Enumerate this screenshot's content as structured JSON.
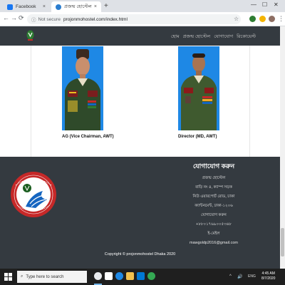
{
  "browser": {
    "tabs": [
      {
        "label": "Facebook",
        "favicon": "facebook-icon"
      },
      {
        "label": "প্রজন্ম হোস্টেল",
        "favicon": "site-favicon"
      }
    ],
    "close_glyph": "×",
    "new_tab_glyph": "+",
    "window_controls": [
      "—",
      "☐",
      "✕"
    ],
    "back_glyph": "←",
    "forward_glyph": "→",
    "reload_glyph": "⟳",
    "security": "Not secure",
    "url": "projonmohostel.com/index.html",
    "bookmark_glyph": "☆",
    "menu_glyph": "⋮"
  },
  "site": {
    "nav_links": [
      "হোম",
      "প্রজন্ম হোস্টেল",
      "যোগাযোগ",
      "রিকোয়েস্ট"
    ],
    "people": [
      {
        "caption": "AG (Vice Chairman, AWT)"
      },
      {
        "caption": "Director (MD, AWT)"
      }
    ],
    "contact": {
      "heading": "যোগাযোগ করুন",
      "lines": [
        "প্রজন্ম হোস্টেল",
        "বাড়ি নং ৪, ক্যাম্প সড়ক",
        "নিউ এয়ারপোর্ট রোড, ঢাকা",
        "ক্যান্টনমেন্ট, ঢাকা-১২০৬",
        "যোগাযোগ করুন",
        "+৮৮০১৭৬৯০০৫৩৬৮",
        "ই-মেইল",
        "mawgoldp2016@gmail.com"
      ]
    },
    "copyright": "Copyright © projonmohostel Dhaka 2020"
  },
  "taskbar": {
    "search_placeholder": "Type here to search",
    "time": "4:45 AM",
    "date": "8/7/2020",
    "tray_glyphs": [
      "^",
      "🔊",
      "ENG"
    ]
  },
  "colors": {
    "navbar": "#343a40",
    "footer": "#343a40",
    "taskbar": "#1f1f1f"
  }
}
